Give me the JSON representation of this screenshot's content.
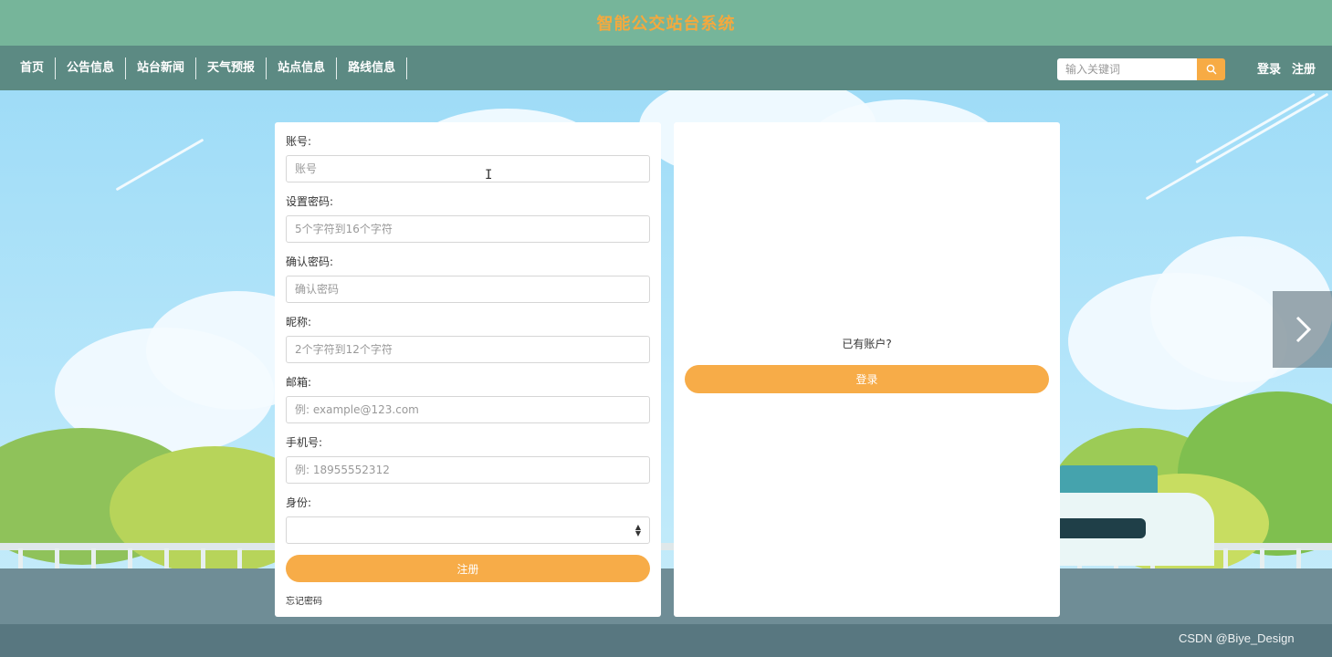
{
  "header": {
    "site_title": "智能公交站台系统"
  },
  "nav": {
    "items": [
      {
        "label": "首页"
      },
      {
        "label": "公告信息"
      },
      {
        "label": "站台新闻"
      },
      {
        "label": "天气预报"
      },
      {
        "label": "站点信息"
      },
      {
        "label": "路线信息"
      }
    ],
    "search_placeholder": "输入关键词",
    "search_icon": "search-icon",
    "login_label": "登录",
    "register_label": "注册"
  },
  "register_form": {
    "fields": [
      {
        "label": "账号:",
        "placeholder": "账号",
        "value": ""
      },
      {
        "label": "设置密码:",
        "placeholder": "5个字符到16个字符",
        "value": ""
      },
      {
        "label": "确认密码:",
        "placeholder": "确认密码",
        "value": ""
      },
      {
        "label": "昵称:",
        "placeholder": "2个字符到12个字符",
        "value": ""
      },
      {
        "label": "邮箱:",
        "placeholder": "例: example@123.com",
        "value": ""
      },
      {
        "label": "手机号:",
        "placeholder": "例: 18955552312",
        "value": ""
      }
    ],
    "role_label": "身份:",
    "role_value": "",
    "submit_label": "注册",
    "forgot_label": "忘记密码"
  },
  "login_panel": {
    "prompt": "已有账户?",
    "login_button_label": "登录"
  },
  "carousel": {
    "next_icon": "chevron-right-icon"
  },
  "watermark": "CSDN @Biye_Design",
  "colors": {
    "title_bar": "#76b59a",
    "nav_bar": "#5c8a83",
    "title_text": "#f4a93e",
    "accent_button": "#f7ac48"
  }
}
